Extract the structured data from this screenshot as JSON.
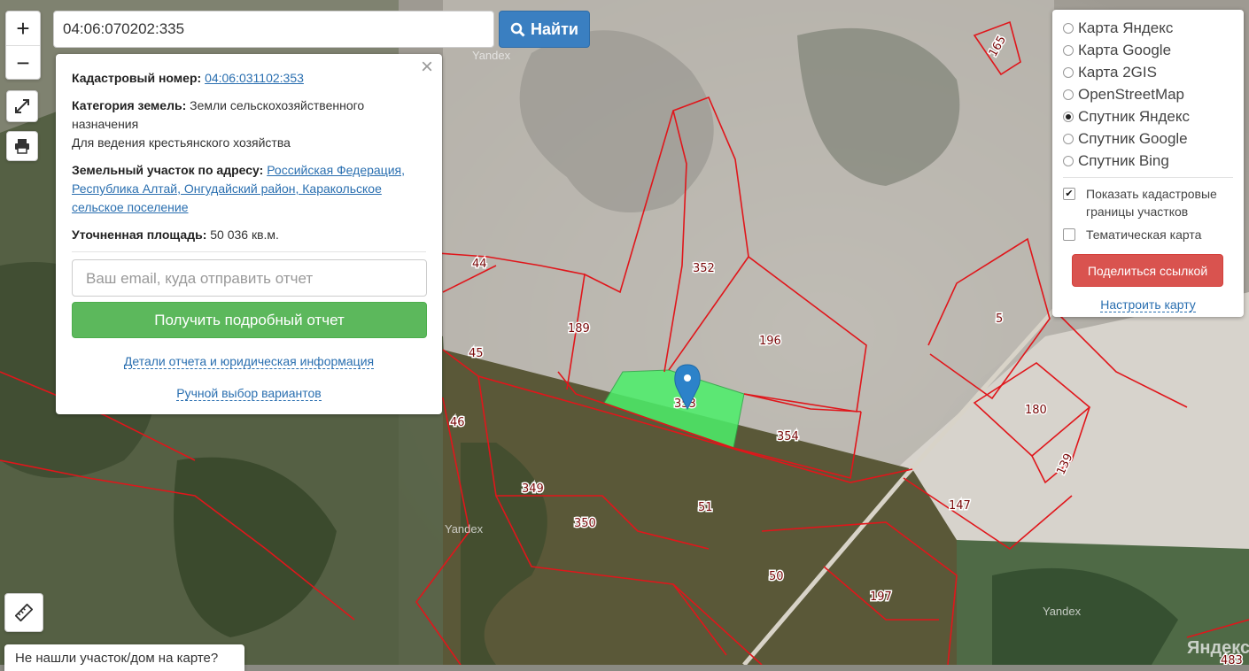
{
  "search": {
    "value": "04:06:070202:335",
    "button_label": "Найти"
  },
  "zoom": {
    "in_label": "+",
    "out_label": "−"
  },
  "parcel_info": {
    "cadastral_label": "Кадастровый номер:",
    "cadastral_number": "04:06:031102:353",
    "category_label": "Категория земель:",
    "category_value": "Земли сельскохозяйственного назначения",
    "use_value": "Для ведения крестьянского хозяйства",
    "address_label": "Земельный участок по адресу:",
    "address_value": "Российская Федерация, Республика Алтай, Онгудайский район, Каракольское сельское поселение",
    "area_label": "Уточненная площадь:",
    "area_value": "50 036 кв.м.",
    "email_placeholder": "Ваш email, куда отправить отчет",
    "report_button": "Получить подробный отчет",
    "details_link": "Детали отчета и юридическая информация",
    "manual_link": "Ручной выбор вариантов",
    "close_label": "×"
  },
  "layers": {
    "options": [
      "Карта Яндекс",
      "Карта Google",
      "Карта 2GIS",
      "OpenStreetMap",
      "Спутник Яндекс",
      "Спутник Google",
      "Спутник Bing"
    ],
    "selected": "Спутник Яндекс",
    "show_boundaries_label": "Показать кадастровые границы участков",
    "show_boundaries_checked": true,
    "thematic_label": "Тематическая карта",
    "thematic_checked": false,
    "share_button": "Поделиться ссылкой",
    "configure_link": "Настроить карту"
  },
  "not_found_text": "Не нашли участок/дом на карте?",
  "map": {
    "parcel_labels": [
      "165",
      "44",
      "352",
      "189",
      "196",
      "5",
      "45",
      "353",
      "180",
      "46",
      "354",
      "139",
      "349",
      "51",
      "147",
      "350",
      "50",
      "197",
      "483"
    ],
    "watermarks": [
      "Yandex",
      "Yandex",
      "Yandex",
      "Яндекс"
    ],
    "colors": {
      "boundary": "#e0161b",
      "selected_parcel": "#4cf06a",
      "marker": "#2c82c9"
    }
  },
  "icons": {
    "fullscreen": "fullscreen-icon",
    "print": "print-icon",
    "ruler": "ruler-icon",
    "search": "search-icon"
  }
}
